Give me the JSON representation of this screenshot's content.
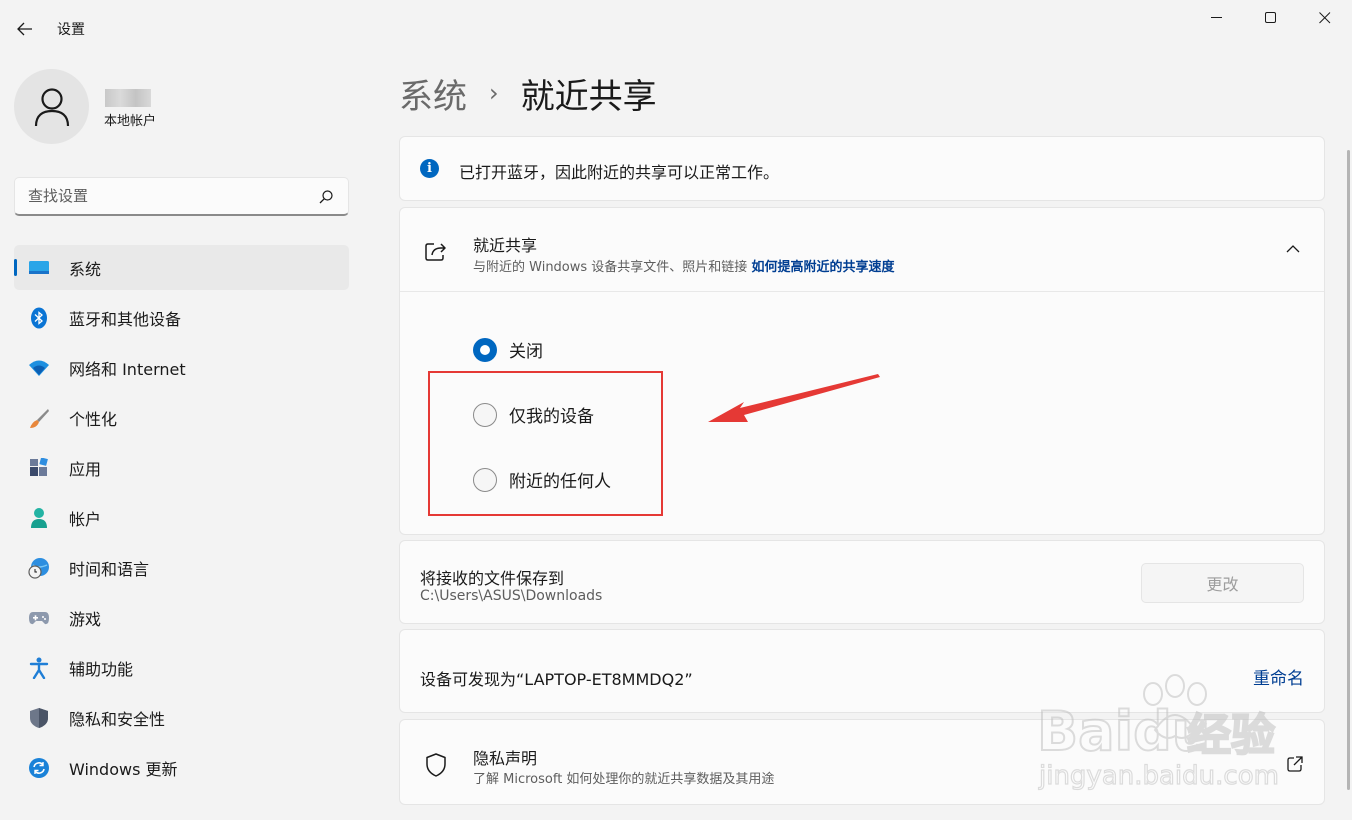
{
  "app": {
    "title": "设置"
  },
  "user": {
    "account_type": "本地帐户"
  },
  "search": {
    "placeholder": "查找设置"
  },
  "sidebar": {
    "items": [
      {
        "label": "系统",
        "icon": "system-icon",
        "active": true
      },
      {
        "label": "蓝牙和其他设备",
        "icon": "bluetooth-icon"
      },
      {
        "label": "网络和 Internet",
        "icon": "wifi-icon"
      },
      {
        "label": "个性化",
        "icon": "brush-icon"
      },
      {
        "label": "应用",
        "icon": "apps-icon"
      },
      {
        "label": "帐户",
        "icon": "account-icon"
      },
      {
        "label": "时间和语言",
        "icon": "time-language-icon"
      },
      {
        "label": "游戏",
        "icon": "gamepad-icon"
      },
      {
        "label": "辅助功能",
        "icon": "accessibility-icon"
      },
      {
        "label": "隐私和安全性",
        "icon": "shield-icon"
      },
      {
        "label": "Windows 更新",
        "icon": "update-icon"
      }
    ]
  },
  "breadcrumb": {
    "parent": "系统",
    "separator": "›",
    "current": "就近共享"
  },
  "info": {
    "icon": "info-icon",
    "glyph": "i",
    "text": "已打开蓝牙，因此附近的共享可以正常工作。"
  },
  "nearby_share": {
    "title": "就近共享",
    "subtitle": "与附近的 Windows 设备共享文件、照片和链接",
    "link": "如何提高附近的共享速度",
    "options": [
      {
        "label": "关闭",
        "selected": true
      },
      {
        "label": "仅我的设备",
        "selected": false
      },
      {
        "label": "附近的任何人",
        "selected": false
      }
    ]
  },
  "save_location": {
    "title": "将接收的文件保存到",
    "path": "C:\\Users\\ASUS\\Downloads",
    "button": "更改"
  },
  "device": {
    "text": "设备可发现为“LAPTOP-ET8MMDQ2”",
    "rename": "重命名"
  },
  "privacy": {
    "title": "隐私声明",
    "subtitle": "了解 Microsoft 如何处理你的就近共享数据及其用途"
  },
  "watermark": {
    "brand": "Baidu",
    "brand_cn": "经验",
    "url": "jingyan.baidu.com"
  },
  "colors": {
    "accent": "#0067c0",
    "link": "#003e92",
    "annotation": "#e53935"
  }
}
